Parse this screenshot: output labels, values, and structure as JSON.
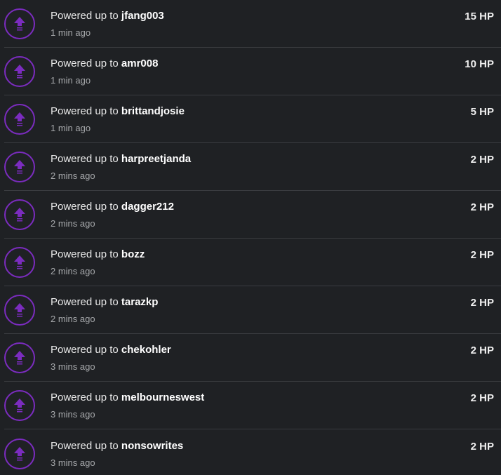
{
  "prefix": "Powered up to",
  "colors": {
    "accent": "#7b2cbf",
    "background": "#1f2124"
  },
  "icon": "power-up-arrow-icon",
  "items": [
    {
      "user": "jfang003",
      "time": "1 min ago",
      "amount": "15 HP"
    },
    {
      "user": "amr008",
      "time": "1 min ago",
      "amount": "10 HP"
    },
    {
      "user": "brittandjosie",
      "time": "1 min ago",
      "amount": "5 HP"
    },
    {
      "user": "harpreetjanda",
      "time": "2 mins ago",
      "amount": "2 HP"
    },
    {
      "user": "dagger212",
      "time": "2 mins ago",
      "amount": "2 HP"
    },
    {
      "user": "bozz",
      "time": "2 mins ago",
      "amount": "2 HP"
    },
    {
      "user": "tarazkp",
      "time": "2 mins ago",
      "amount": "2 HP"
    },
    {
      "user": "chekohler",
      "time": "3 mins ago",
      "amount": "2 HP"
    },
    {
      "user": "melbourneswest",
      "time": "3 mins ago",
      "amount": "2 HP"
    },
    {
      "user": "nonsowrites",
      "time": "3 mins ago",
      "amount": "2 HP"
    }
  ]
}
